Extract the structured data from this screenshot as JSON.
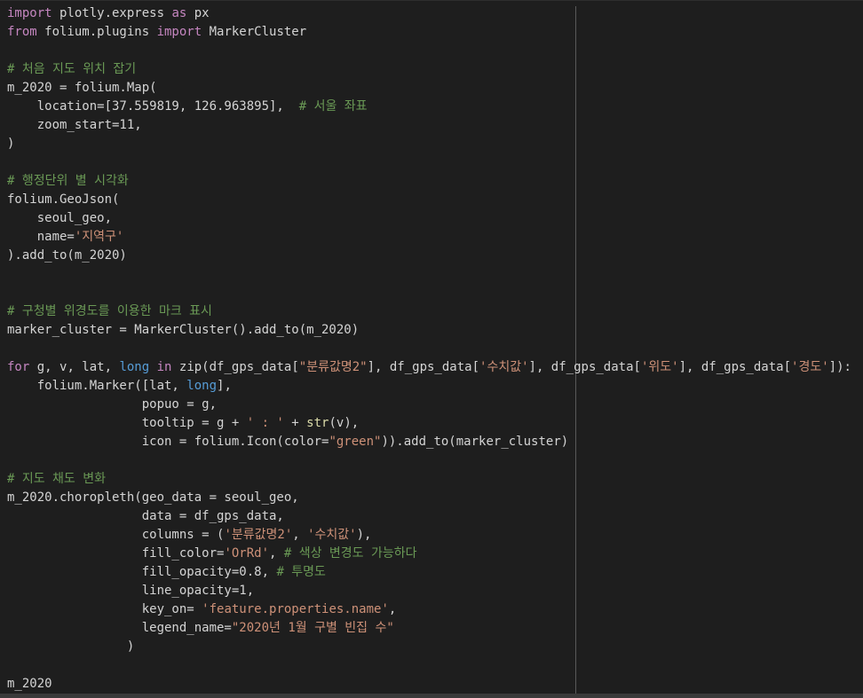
{
  "colors": {
    "background": "#1e1e1e",
    "keyword": "#c586c0",
    "keyword_alt": "#569cd6",
    "string": "#ce9178",
    "comment": "#6a9955",
    "builtin": "#dcdcaa",
    "text": "#d4d4d4"
  },
  "code": {
    "lines": [
      [
        {
          "t": "import",
          "c": "kw"
        },
        {
          "t": " plotly.express ",
          "c": "txt"
        },
        {
          "t": "as",
          "c": "kw"
        },
        {
          "t": " px",
          "c": "txt"
        }
      ],
      [
        {
          "t": "from",
          "c": "kw"
        },
        {
          "t": " folium.plugins ",
          "c": "txt"
        },
        {
          "t": "import",
          "c": "kw"
        },
        {
          "t": " MarkerCluster",
          "c": "txt"
        }
      ],
      [],
      [
        {
          "t": "# 처음 지도 위치 잡기",
          "c": "cmt"
        }
      ],
      [
        {
          "t": "m_2020 = folium.Map(",
          "c": "txt"
        }
      ],
      [
        {
          "t": "    location=[37.559819, 126.963895],  ",
          "c": "txt"
        },
        {
          "t": "# 서울 좌표",
          "c": "cmt"
        }
      ],
      [
        {
          "t": "    zoom_start=11,",
          "c": "txt"
        }
      ],
      [
        {
          "t": ")",
          "c": "txt"
        }
      ],
      [],
      [
        {
          "t": "# 행정단위 별 시각화",
          "c": "cmt"
        }
      ],
      [
        {
          "t": "folium.GeoJson(",
          "c": "txt"
        }
      ],
      [
        {
          "t": "    seoul_geo,",
          "c": "txt"
        }
      ],
      [
        {
          "t": "    name=",
          "c": "txt"
        },
        {
          "t": "'지역구'",
          "c": "str"
        }
      ],
      [
        {
          "t": ").add_to(m_2020)",
          "c": "txt"
        }
      ],
      [],
      [],
      [
        {
          "t": "# 구청별 위경도를 이용한 마크 표시",
          "c": "cmt"
        }
      ],
      [
        {
          "t": "marker_cluster = MarkerCluster().add_to(m_2020)",
          "c": "txt"
        }
      ],
      [],
      [
        {
          "t": "for",
          "c": "kw"
        },
        {
          "t": " g, v, lat, ",
          "c": "txt"
        },
        {
          "t": "long",
          "c": "kw2"
        },
        {
          "t": " ",
          "c": "txt"
        },
        {
          "t": "in",
          "c": "kw"
        },
        {
          "t": " zip(df_gps_data[",
          "c": "txt"
        },
        {
          "t": "\"분류값명2\"",
          "c": "str"
        },
        {
          "t": "], df_gps_data[",
          "c": "txt"
        },
        {
          "t": "'수치값'",
          "c": "str"
        },
        {
          "t": "], df_gps_data[",
          "c": "txt"
        },
        {
          "t": "'위도'",
          "c": "str"
        },
        {
          "t": "], df_gps_data[",
          "c": "txt"
        },
        {
          "t": "'경도'",
          "c": "str"
        },
        {
          "t": "]):",
          "c": "txt"
        }
      ],
      [
        {
          "t": "    folium.Marker([lat, ",
          "c": "txt"
        },
        {
          "t": "long",
          "c": "kw2"
        },
        {
          "t": "],",
          "c": "txt"
        }
      ],
      [
        {
          "t": "                  popuo = g,",
          "c": "txt"
        }
      ],
      [
        {
          "t": "                  tooltip = g + ",
          "c": "txt"
        },
        {
          "t": "' : '",
          "c": "str"
        },
        {
          "t": " + ",
          "c": "txt"
        },
        {
          "t": "str",
          "c": "fn"
        },
        {
          "t": "(v),",
          "c": "txt"
        }
      ],
      [
        {
          "t": "                  icon = folium.Icon(color=",
          "c": "txt"
        },
        {
          "t": "\"green\"",
          "c": "str"
        },
        {
          "t": ")).add_to(marker_cluster)",
          "c": "txt"
        }
      ],
      [],
      [
        {
          "t": "# 지도 채도 변화",
          "c": "cmt"
        }
      ],
      [
        {
          "t": "m_2020.choropleth(geo_data = seoul_geo,",
          "c": "txt"
        }
      ],
      [
        {
          "t": "                  data = df_gps_data,",
          "c": "txt"
        }
      ],
      [
        {
          "t": "                  columns = (",
          "c": "txt"
        },
        {
          "t": "'분류값명2'",
          "c": "str"
        },
        {
          "t": ", ",
          "c": "txt"
        },
        {
          "t": "'수치값'",
          "c": "str"
        },
        {
          "t": "),",
          "c": "txt"
        }
      ],
      [
        {
          "t": "                  fill_color=",
          "c": "txt"
        },
        {
          "t": "'OrRd'",
          "c": "str"
        },
        {
          "t": ", ",
          "c": "txt"
        },
        {
          "t": "# 색상 변경도 가능하다",
          "c": "cmt"
        }
      ],
      [
        {
          "t": "                  fill_opacity=0.8, ",
          "c": "txt"
        },
        {
          "t": "# 투명도",
          "c": "cmt"
        }
      ],
      [
        {
          "t": "                  line_opacity=1,",
          "c": "txt"
        }
      ],
      [
        {
          "t": "                  key_on= ",
          "c": "txt"
        },
        {
          "t": "'feature.properties.name'",
          "c": "str"
        },
        {
          "t": ",",
          "c": "txt"
        }
      ],
      [
        {
          "t": "                  legend_name=",
          "c": "txt"
        },
        {
          "t": "\"2020년 1월 구별 빈집 수\"",
          "c": "str"
        }
      ],
      [
        {
          "t": "                )",
          "c": "txt"
        }
      ],
      [],
      [
        {
          "t": "m_2020",
          "c": "txt"
        }
      ]
    ]
  }
}
